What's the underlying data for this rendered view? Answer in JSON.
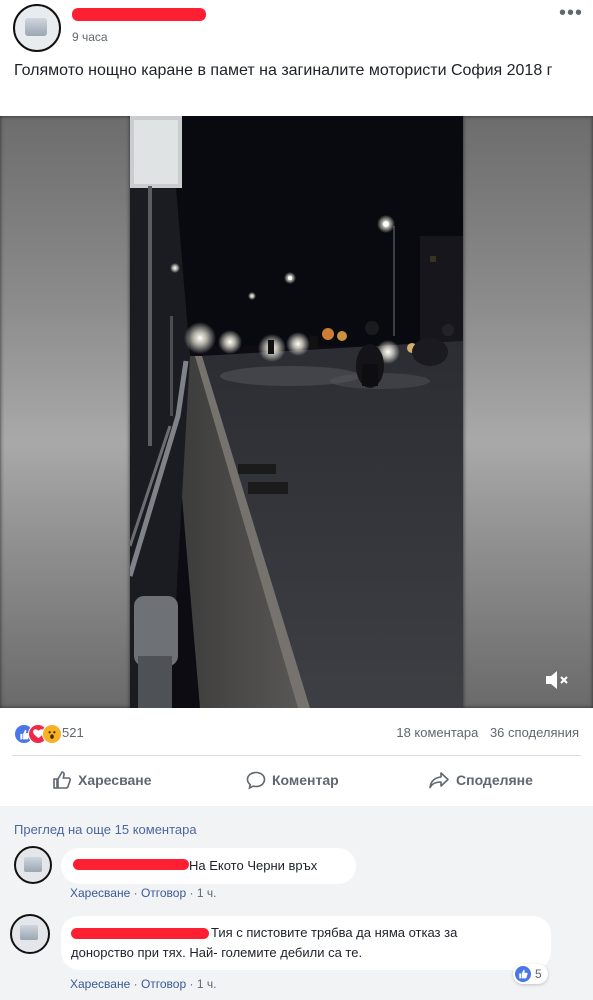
{
  "post": {
    "time": "9 часа",
    "more_icon": "ellipsis-icon",
    "text": "Голямото нощно каране в памет на загиналите мотористи София 2018 г"
  },
  "video": {
    "mute_icon": "volume-muted-icon"
  },
  "stats": {
    "reaction_count": "521",
    "comments": "18 коментара",
    "shares": "36 споделяния",
    "reactions": [
      "like",
      "love",
      "wow"
    ]
  },
  "actions": {
    "like": "Харесване",
    "comment": "Коментар",
    "share": "Споделяне"
  },
  "comments": {
    "view_more": "Преглед на още 15 коментара",
    "items": [
      {
        "text": "На Екото Черни връх",
        "like": "Харесване",
        "reply": "Отговор",
        "time": "1 ч."
      },
      {
        "text_line1": "Тия с пистовите трябва да няма отказ за",
        "text_line2": "донорство при тях. Най- големите дебили са те.",
        "like": "Харесване",
        "reply": "Отговор",
        "time": "1 ч.",
        "likes": "5"
      }
    ]
  },
  "colors": {
    "like_blue": "#4a76e8",
    "love_red": "#f0284a",
    "wow_yellow": "#f7b125",
    "redaction": "#ff1f33"
  }
}
